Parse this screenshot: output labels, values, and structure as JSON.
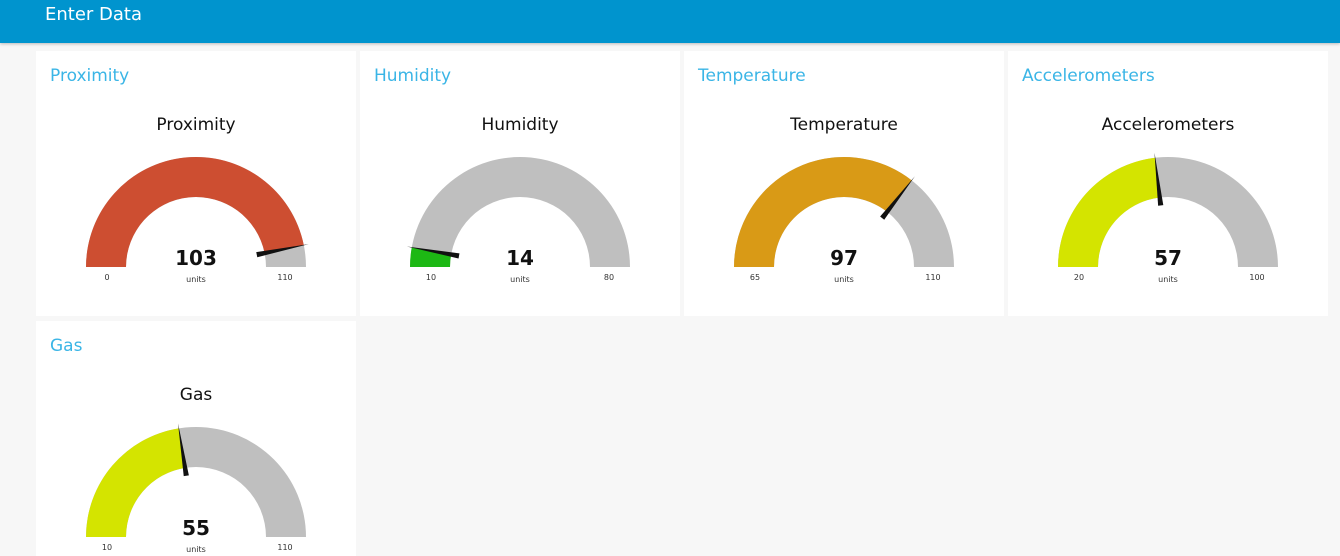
{
  "toolbar": {
    "title": "Enter Data"
  },
  "colors": {
    "toolbar": "#0094ce",
    "group_title": "#3ab5e6",
    "track": "#bfbfbf",
    "needle": "#111111"
  },
  "groups": [
    {
      "title": "Proximity",
      "gauge": {
        "label": "Proximity",
        "value": 103,
        "units": "units",
        "min": 0,
        "max": 110,
        "color": "#cd4e31"
      }
    },
    {
      "title": "Humidity",
      "gauge": {
        "label": "Humidity",
        "value": 14,
        "units": "units",
        "min": 10,
        "max": 80,
        "color": "#1db814"
      }
    },
    {
      "title": "Temperature",
      "gauge": {
        "label": "Temperature",
        "value": 97,
        "units": "units",
        "min": 65,
        "max": 110,
        "color": "#d99a16"
      }
    },
    {
      "title": "Accelerometers",
      "gauge": {
        "label": "Accelerometers",
        "value": 57,
        "units": "units",
        "min": 20,
        "max": 100,
        "color": "#d4e400"
      }
    },
    {
      "title": "Gas",
      "gauge": {
        "label": "Gas",
        "value": 55,
        "units": "units",
        "min": 10,
        "max": 110,
        "color": "#d4e400"
      }
    }
  ]
}
